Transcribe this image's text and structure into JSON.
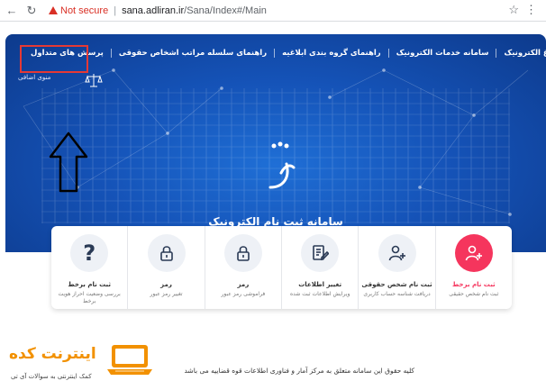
{
  "browser": {
    "security": "Not secure",
    "url_host": "sana.adliran.ir",
    "url_path": "/Sana/Index#/Main"
  },
  "nav": {
    "items": [
      "سامانه ابلاغ الکترونیک",
      "سامانه خدمات الکترونیک",
      "راهنمای گروه بندی ابلاغیه",
      "راهنمای سلسله مراتب اشخاص حقوقی",
      "پرسش های متداول"
    ],
    "second_row": "منوی اضافی"
  },
  "hero": {
    "title": "سامانه ثبت نام الکترونیک"
  },
  "cards": [
    {
      "title": "ثبت نام برخط",
      "desc": "ثبت نام شخص حقیقی",
      "icon": "add-user-icon",
      "accent": true
    },
    {
      "title": "ثبت نام شخص حقوقی",
      "desc": "دریافت شناسه حساب کاربری",
      "icon": "add-user-icon",
      "accent": false
    },
    {
      "title": "تغییر اطلاعات",
      "desc": "ویرایش اطلاعات ثبت شده",
      "icon": "edit-document-icon",
      "accent": false
    },
    {
      "title": "رمز",
      "desc": "فراموشی رمز عبور",
      "icon": "lock-icon",
      "accent": false
    },
    {
      "title": "رمز",
      "desc": "تغییر رمز عبور",
      "icon": "lock-icon",
      "accent": false
    },
    {
      "title": "ثبت نام برخط",
      "desc": "بررسی وضعیت احراز هویت برخط",
      "icon": "question-icon",
      "accent": false
    }
  ],
  "footer": {
    "text": "کلیه حقوق این سامانه متعلق به مرکز آمار و فناوری اطلاعات قوه قضاییه می باشد"
  },
  "watermark": {
    "text": "اینترنت کده",
    "sub": "کمک اینترنتی به سوالات آی تی"
  },
  "colors": {
    "hero": "#1553b8",
    "accent": "#f5355d",
    "warn": "#d93025",
    "watermark": "#f29100"
  }
}
